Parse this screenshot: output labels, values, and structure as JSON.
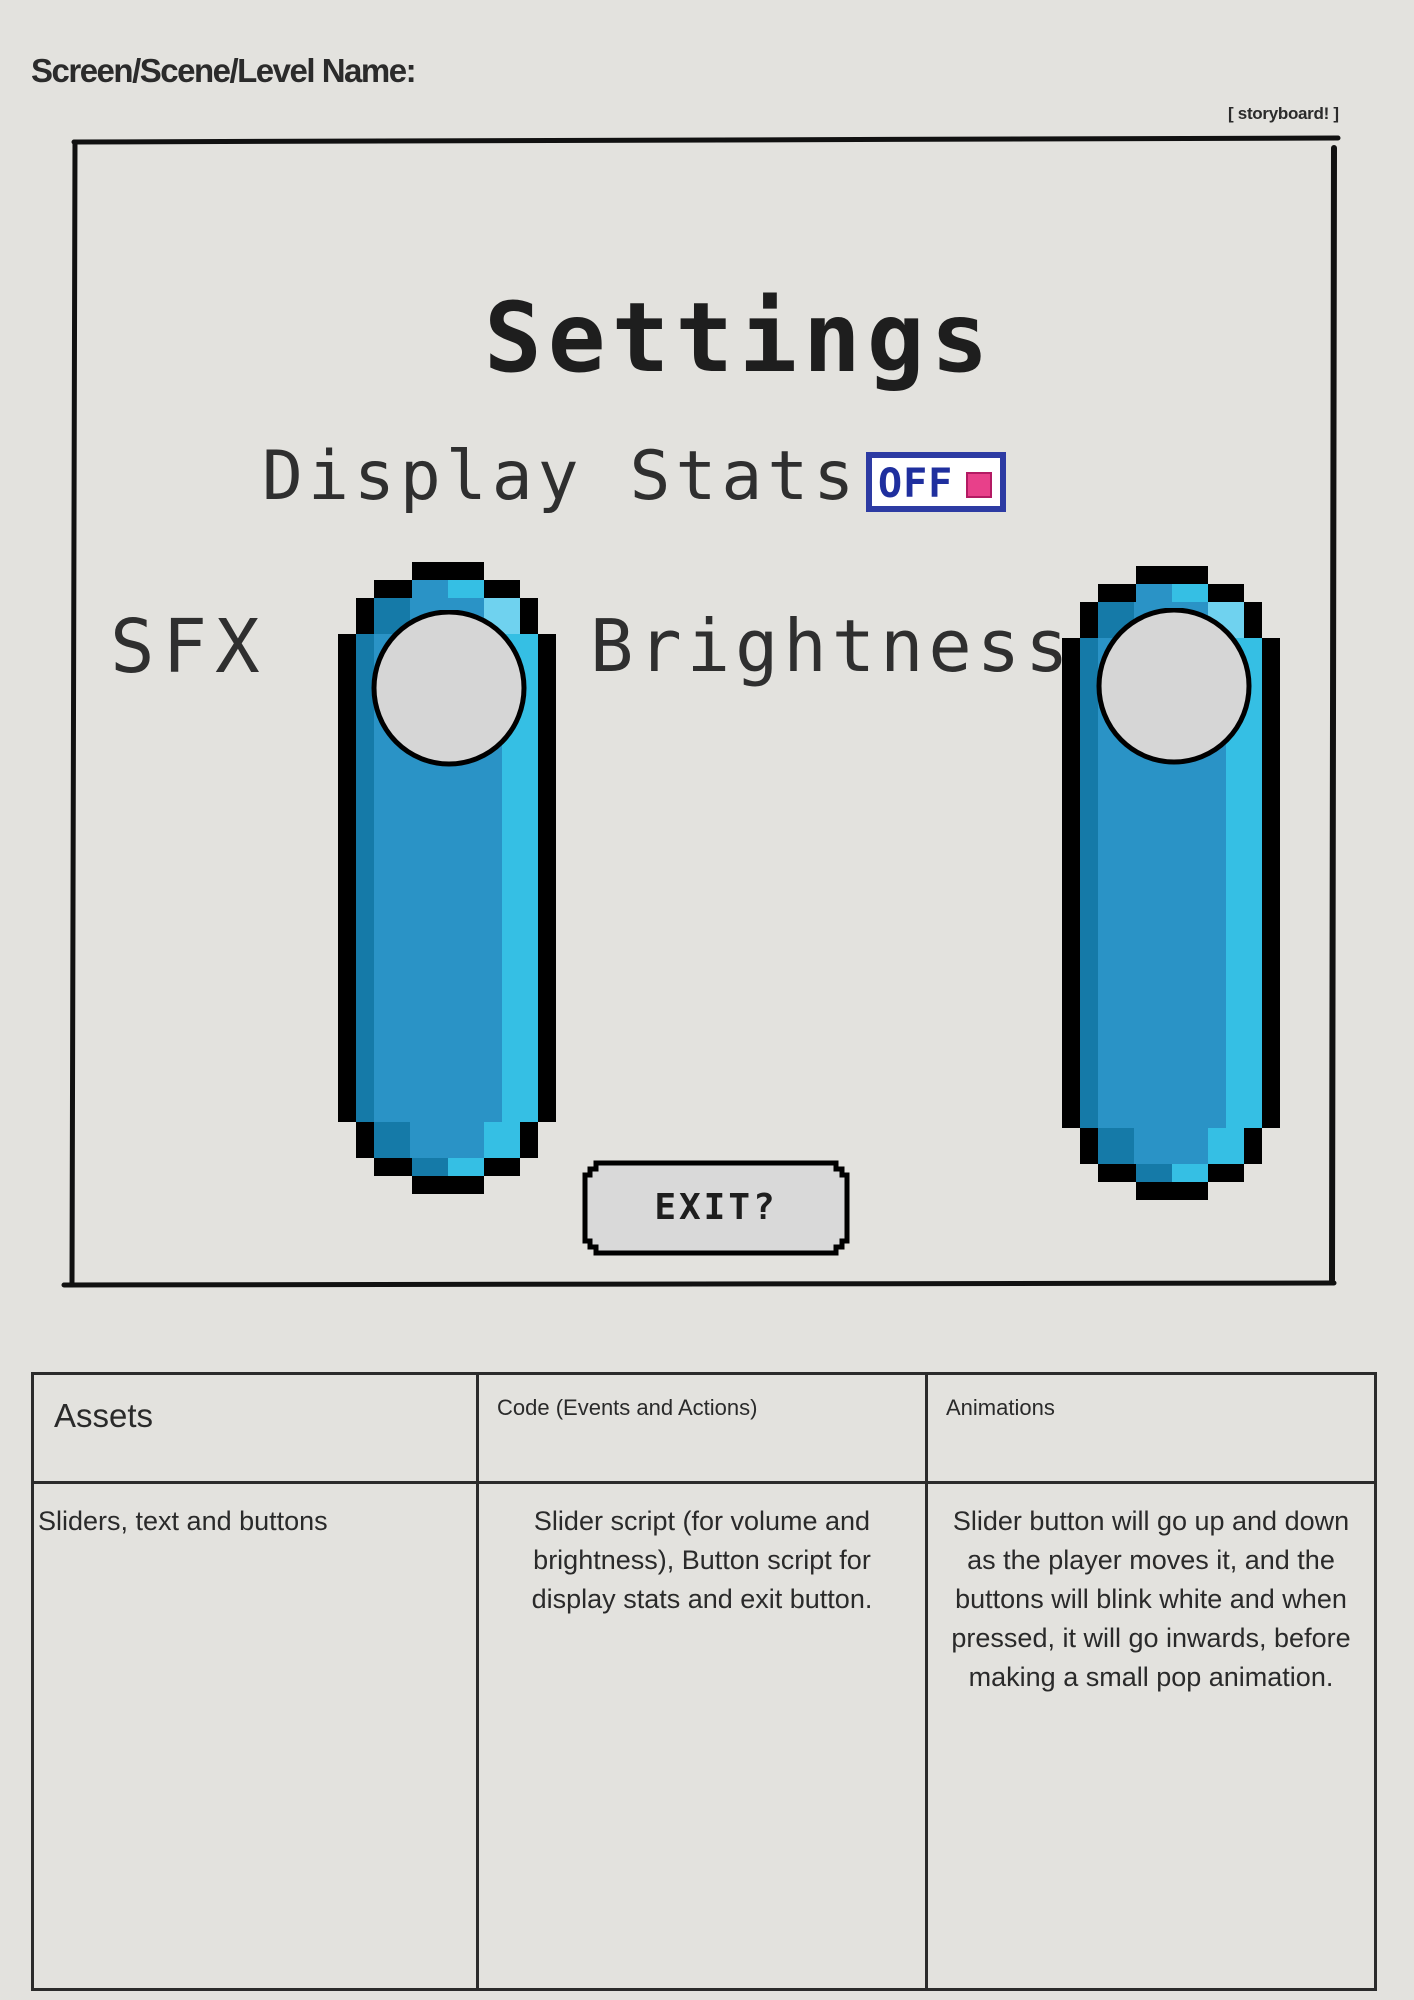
{
  "header": {
    "screen_name_label": "Screen/Scene/Level Name:",
    "tag": "[ storyboard! ]"
  },
  "mockup": {
    "title": "Settings",
    "display_stats": {
      "label": "Display Stats",
      "toggle_text": "OFF",
      "toggle_state": "off"
    },
    "sfx_slider": {
      "label": "SFX",
      "level": 1.0
    },
    "brightness_slider": {
      "label": "Brightness",
      "level": 1.0
    },
    "exit_button": {
      "label": "EXIT?"
    }
  },
  "colors": {
    "background": "#e3e2de",
    "slider_blue": "#2a93c6",
    "slider_highlight": "#35bfe4",
    "slider_shadow": "#157aa8",
    "knob": "#d6d6d6",
    "toggle_border": "#2d3ba3",
    "toggle_dot": "#e8408a"
  },
  "notes_table": {
    "headers": [
      "Assets",
      "Code (Events and Actions)",
      "Animations"
    ],
    "assets": "Sliders, text and buttons",
    "code": "Slider script (for volume and brightness), Button script for display stats and exit button.",
    "animations": "Slider button will go up and down as the player moves it, and the buttons will blink white and when pressed, it will go inwards, before making a small pop animation."
  }
}
